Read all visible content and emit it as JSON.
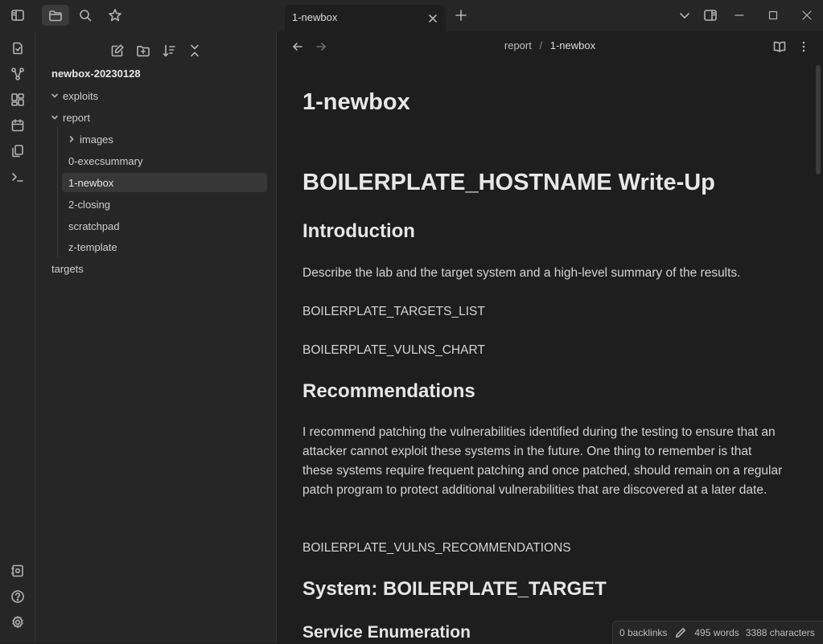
{
  "tabs": [
    {
      "title": "1-newbox"
    }
  ],
  "top_icons": [
    "sidebar-toggle-icon",
    "folder-icon",
    "search-icon",
    "star-icon",
    "chevron-down-icon",
    "right-sidebar-icon",
    "minimize-icon",
    "maximize-icon",
    "close-icon"
  ],
  "ribbon_icons": [
    "open-note-icon",
    "graph-view-icon",
    "canvas-icon",
    "daily-note-icon",
    "templates-icon",
    "command-palette-icon",
    "vault-icon",
    "help-icon",
    "settings-icon"
  ],
  "sidebar": {
    "vault_name": "newbox-20230128",
    "tree": [
      {
        "label": "exploits",
        "type": "folder",
        "expanded": true
      },
      {
        "label": "report",
        "type": "folder",
        "expanded": true
      },
      {
        "label": "images",
        "type": "folder",
        "expanded": false
      },
      {
        "label": "0-execsummary",
        "type": "file"
      },
      {
        "label": "1-newbox",
        "type": "file",
        "active": true
      },
      {
        "label": "2-closing",
        "type": "file"
      },
      {
        "label": "scratchpad",
        "type": "file"
      },
      {
        "label": "z-template",
        "type": "file"
      },
      {
        "label": "targets",
        "type": "file"
      }
    ]
  },
  "editor": {
    "breadcrumb": {
      "folder": "report",
      "separator": "/",
      "file": "1-newbox"
    },
    "inline_title": "1-newbox",
    "h1": "BOILERPLATE_HOSTNAME Write-Up",
    "h2_intro": "Introduction",
    "p_intro": "Describe the lab and the target system and a high-level summary of the results.",
    "p_targets": "BOILERPLATE_TARGETS_LIST",
    "p_chart": "BOILERPLATE_VULNS_CHART",
    "h2_recs": "Recommendations",
    "p_recs": "I recommend patching the vulnerabilities identified during the testing to ensure that an attacker cannot exploit these systems in the future.  One thing to remember is that these systems require frequent patching and once patched, should remain on a regular patch program to protect additional vulnerabilities that are discovered at a later date.",
    "p_recs_list": "BOILERPLATE_VULNS_RECOMMENDATIONS",
    "h2_system": "System: BOILERPLATE_TARGET",
    "h3_enum": "Service Enumeration"
  },
  "status": {
    "backlinks": "0 backlinks",
    "words": "495 words",
    "characters": "3388 characters"
  },
  "colors": {
    "background": "#1e1e1e",
    "panel": "#262626",
    "active_row": "#373737",
    "text": "#dadada"
  }
}
